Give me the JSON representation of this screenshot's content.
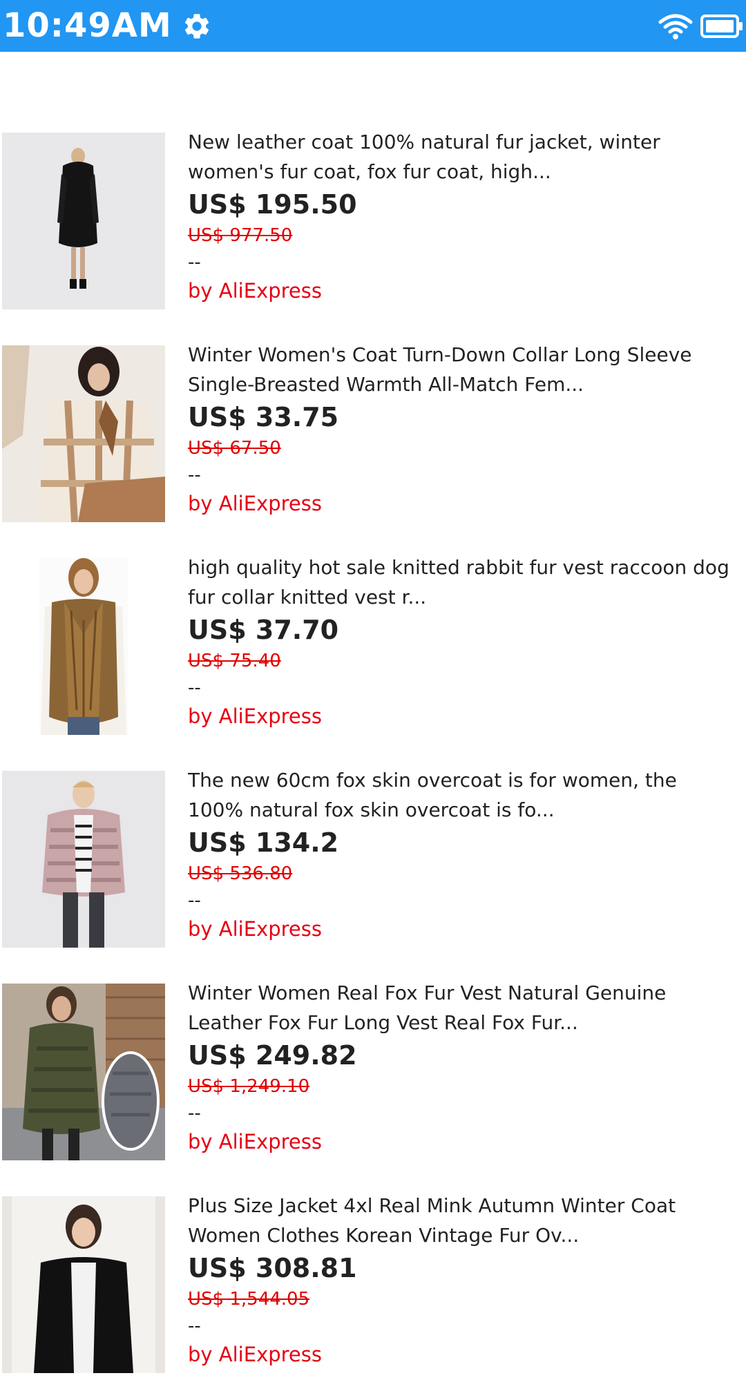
{
  "status_bar": {
    "time": "10:49AM",
    "icons": [
      "gear-icon",
      "wifi-icon",
      "battery-icon"
    ],
    "color": "#2196F3"
  },
  "products": [
    {
      "title": "New leather coat 100% natural fur jacket, winter women's fur coat, fox fur coat, high...",
      "price": "US$ 195.50",
      "old_price": "US$ 977.50",
      "rating": "--",
      "seller": "by AliExpress"
    },
    {
      "title": "Winter Women's Coat Turn-Down Collar Long Sleeve Single-Breasted Warmth All-Match Fem...",
      "price": "US$ 33.75",
      "old_price": "US$ 67.50",
      "rating": "--",
      "seller": "by AliExpress"
    },
    {
      "title": "high quality hot sale knitted rabbit fur vest raccoon dog fur collar knitted vest r...",
      "price": "US$ 37.70",
      "old_price": "US$ 75.40",
      "rating": "--",
      "seller": "by AliExpress"
    },
    {
      "title": "The new 60cm fox skin overcoat is for women, the 100% natural fox skin overcoat is fo...",
      "price": "US$ 134.2",
      "old_price": "US$ 536.80",
      "rating": "--",
      "seller": "by AliExpress"
    },
    {
      "title": "Winter Women Real Fox Fur Vest Natural Genuine Leather Fox Fur Long Vest Real Fox Fur...",
      "price": "US$ 249.82",
      "old_price": "US$ 1,249.10",
      "rating": "--",
      "seller": "by AliExpress"
    },
    {
      "title": "Plus Size Jacket 4xl Real Mink Autumn Winter Coat Women Clothes Korean Vintage Fur Ov...",
      "price": "US$ 308.81",
      "old_price": "US$ 1,544.05",
      "rating": "--",
      "seller": "by AliExpress"
    }
  ],
  "colors": {
    "price_old": "#e00000",
    "seller": "#e60012",
    "text": "#222222"
  }
}
